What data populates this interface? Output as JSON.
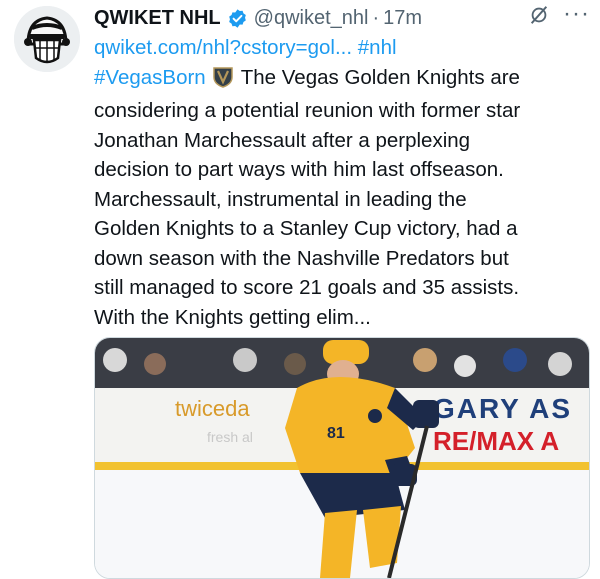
{
  "tweet": {
    "display_name": "QWIKET NHL",
    "handle": "@qwiket_nhl",
    "separator": "·",
    "time": "17m",
    "more_label": "···",
    "link_text": "qwiket.com/nhl?cstory=gol...",
    "hashtag1": "#nhl",
    "hashtag2": "#VegasBorn",
    "text_lines": [
      "The Vegas Golden Knights are",
      "considering a potential reunion with former star",
      "Jonathan Marchessault after a perplexing",
      "decision to part ways with him last offseason.",
      "Marchessault, instrumental in leading the",
      "Golden Knights to a Stanley Cup victory, had a",
      "down season with the Nashville Predators but",
      "still managed to score 21 goals and 35 assists.",
      "With the Knights getting elim..."
    ]
  },
  "media": {
    "board_ad_left": "twiceda",
    "board_ad_sub": "fresh al",
    "board_ad_right_1": "GARY AS",
    "board_ad_right_2": "RE/MAX A",
    "jersey_number": "81"
  },
  "colors": {
    "link": "#1d9bf0",
    "verified": "#1d9bf0",
    "secondary_text": "#536471",
    "jersey_gold": "#f4b527",
    "jersey_navy": "#1c2a4a"
  },
  "icons": {
    "avatar": "hockey-player-avatar",
    "verified": "verified-badge-icon",
    "grok": "grok-icon",
    "more": "more-options-icon",
    "knights_badge": "vegas-golden-knights-logo"
  }
}
